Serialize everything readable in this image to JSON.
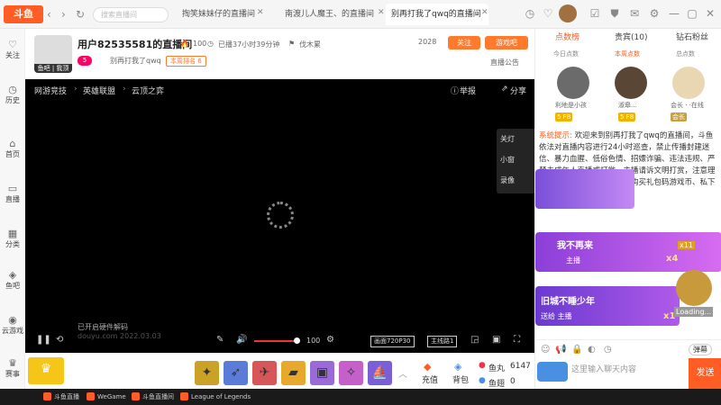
{
  "topbar": {
    "logo": "斗鱼",
    "search_placeholder": "搜索直播间",
    "tabs": [
      {
        "label": "掏笑妹妹仔的直播间"
      },
      {
        "label": "南渡儿人魔王、的直播间"
      },
      {
        "label": "别再打我了qwq的直播间"
      }
    ],
    "tab_close": "✕"
  },
  "leftnav": [
    {
      "label": "关注",
      "icon": "heart-icon"
    },
    {
      "label": "历史",
      "icon": "clock-icon"
    },
    {
      "label": "首页",
      "icon": "home-icon"
    },
    {
      "label": "直播",
      "icon": "tv-icon"
    },
    {
      "label": "分类",
      "icon": "grid-icon"
    },
    {
      "label": "鱼吧",
      "icon": "fish-icon"
    },
    {
      "label": "云游戏",
      "icon": "gamepad-icon"
    },
    {
      "label": "赛事",
      "icon": "trophy-icon"
    }
  ],
  "header": {
    "avatar_label": "鱼吧 | 我顶",
    "title": "用户82535581的直播间",
    "heat": "100",
    "duration": "已播37小时39分钟",
    "author": "伐木累",
    "level": "5",
    "sub": "别再打我了qwq",
    "rank": "本周排名 6",
    "fans": "2028",
    "follow": "关注",
    "game": "游戏吧",
    "notice": "直播公告"
  },
  "player": {
    "breadcrumb": [
      "网游竞技",
      "英雄联盟",
      "云顶之弈"
    ],
    "report": "举报",
    "share": "分享",
    "side": [
      "关灯",
      "小窗",
      "录像"
    ],
    "hw": "已开启硬件解码",
    "watermark": "douyu.com 2022.03.03",
    "volume": "100",
    "quality": "画面720P30",
    "line": "主线路1"
  },
  "gifts": {
    "recharge": "充值",
    "backpack": "背包",
    "fishball_label": "鱼丸",
    "fishball": "6147",
    "fishcoin_label": "鱼翅",
    "fishcoin": "0"
  },
  "right": {
    "tabs": [
      "点数榜",
      "贵宾(10)",
      "钻石粉丝"
    ],
    "subtabs": [
      "今日点数",
      "本周点数",
      "总点数"
    ],
    "users": [
      {
        "name": "利地是小孩",
        "badge": "5 F8"
      },
      {
        "name": "淑皋...",
        "badge": "5 F8"
      },
      {
        "name": "会长 · ·在线",
        "badge": "会长"
      }
    ],
    "system_label": "系统提示:",
    "system_msg": "欢迎来到别再打我了qwq的直播间，斗鱼依法对直播内容进行24小时巡查，禁止传播封建迷信、暴力血腥、低俗色情、招嫖诈骗、违法违规、严禁未成年人直播或打赏、主播请诉文明打赏，注意理性消费。警惕招聘类诈骗、购买礼包码游戏币、私下交易等信息。",
    "banners": [
      {
        "text": "我不再来",
        "sub": "主播",
        "count": "x4",
        "count2": "x11"
      },
      {
        "text": "旧城不睡少年",
        "sub": "送给 主播",
        "count": "x1"
      }
    ],
    "loading": "Loading...",
    "input_placeholder": "这里输入聊天内容",
    "send": "发送",
    "barrage": "弹幕"
  },
  "taskbar": [
    {
      "label": "斗鱼直播"
    },
    {
      "label": "WeGame"
    },
    {
      "label": "斗鱼直播间"
    },
    {
      "label": "League of Legends"
    }
  ]
}
